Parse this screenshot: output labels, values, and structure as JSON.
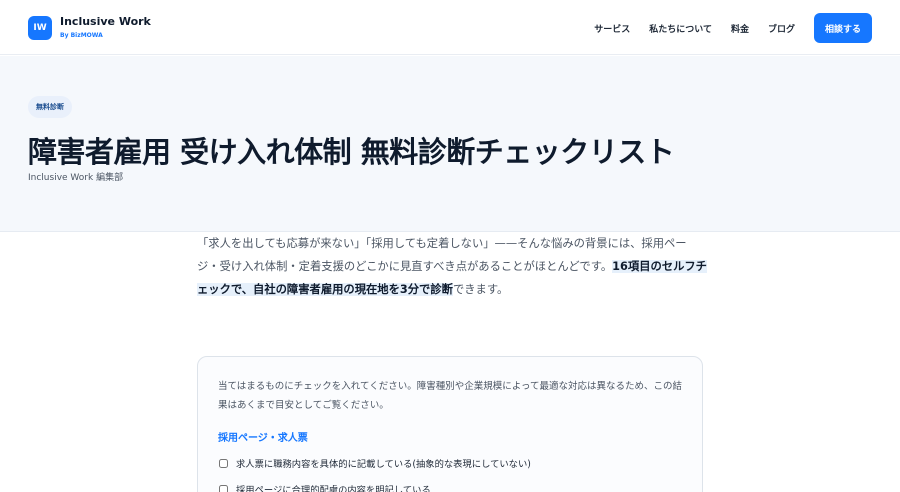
{
  "header": {
    "logo_mark": "IW",
    "logo_title": "Inclusive Work",
    "logo_sub": "By BizMOWA",
    "nav": [
      "サービス",
      "私たちについて",
      "料金",
      "ブログ"
    ],
    "cta": "相談する"
  },
  "hero": {
    "badge": "無料診断",
    "title": "障害者雇用 受け入れ体制 無料診断チェックリスト",
    "byline": "Inclusive Work 編集部"
  },
  "intro": {
    "text": "「求人を出しても応募が来ない」「採用しても定着しない」——そんな悩みの背景には、採用ページ・受け入れ体制・定着支援のどこかに見直すべき点があることがほとんどです。",
    "highlight": "16項目のセルフチェックで、自社の障害者雇用の現在地を3分で診断",
    "tail": "できます。"
  },
  "checklist": {
    "description": "当てはまるものにチェックを入れてください。障害種別や企業規模によって最適な対応は異なるため、この結果はあくまで目安としてご覧ください。",
    "section_title": "採用ページ・求人票",
    "items": [
      "求人票に職務内容を具体的に記載している(抽象的な表現にしていない)",
      "採用ページに合理的配慮の内容を明記している"
    ]
  },
  "colors": {
    "accent": "#1677ff",
    "hero_bg": "#f5f8fc",
    "title": "#0f1b2d"
  }
}
